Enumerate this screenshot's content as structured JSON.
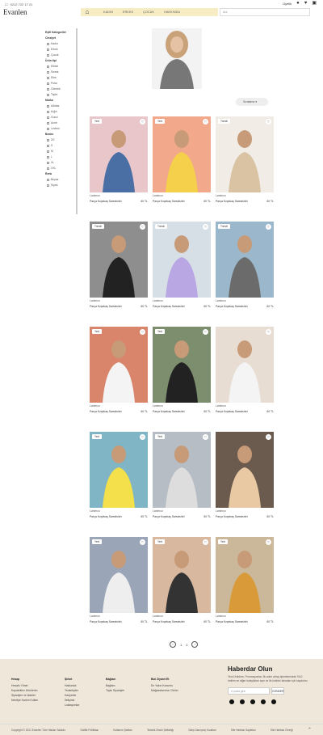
{
  "topbar": {
    "phone": "0212 722 17 21"
  },
  "header": {
    "logo": "Evanlen",
    "nav": [
      {
        "label": "KADIN"
      },
      {
        "label": "ERKEK"
      },
      {
        "label": "ÇOCUK"
      },
      {
        "label": "HAKKINDA"
      }
    ],
    "search_placeholder": "Ara",
    "user_label": "Üyelik"
  },
  "filters": {
    "groups": [
      {
        "title": "Eşfil Kategoriler",
        "items": []
      },
      {
        "title": "Cinsiyet",
        "items": [
          "Kadın",
          "Erkek",
          "Çocuk"
        ]
      },
      {
        "title": "Ürün tipi",
        "items": [
          "Elbise",
          "Sweat",
          "Etek",
          "Polar",
          "Gömlek",
          "Tişört"
        ]
      },
      {
        "title": "Marka",
        "items": [
          "Adidas",
          "Kığılı",
          "Gucci",
          "Acne",
          "Levimo"
        ]
      },
      {
        "title": "Beden",
        "items": [
          "XS",
          "S",
          "M",
          "L",
          "XL",
          "XXL"
        ]
      },
      {
        "title": "Renk",
        "items": [
          "Beyaz",
          "Siyah"
        ]
      }
    ]
  },
  "sort_label": "Sıralama",
  "products": [
    {
      "badge": "Yeni",
      "brand": "Lanimco",
      "name": "Parça Koşekaş Sweatshirt",
      "price": "60 TL"
    },
    {
      "badge": "Yeni",
      "brand": "Lanimco",
      "name": "Parça Koşekaş Sweatshirt",
      "price": "60 TL"
    },
    {
      "badge": "Trendl",
      "brand": "Lanimco",
      "name": "Parça Koşekaş Sweatshirt",
      "price": "60 TL"
    },
    {
      "badge": "Trendl",
      "brand": "Lanimco",
      "name": "Parça Koşekaş Sweatshirt",
      "price": "60 TL"
    },
    {
      "badge": "Trendl",
      "brand": "Lanimco",
      "name": "Parça Koşekaş Sweatshirt",
      "price": "60 TL"
    },
    {
      "badge": "Trendl",
      "brand": "Lanimco",
      "name": "Parça Koşekaş Sweatshirt",
      "price": "60 TL"
    },
    {
      "badge": "Yeni",
      "brand": "Lanimco",
      "name": "Parça Koşekaş Sweatshirt",
      "price": "60 TL"
    },
    {
      "badge": "Yeni",
      "brand": "Lanimco",
      "name": "Parça Koşekaş Sweatshirt",
      "price": "60 TL"
    },
    {
      "badge": "",
      "brand": "Lanimco",
      "name": "Parça Koşekaş Sweatshirt",
      "price": "60 TL"
    },
    {
      "badge": "Yeni",
      "brand": "Lanimco",
      "name": "Parça Koşekaş Sweatshirt",
      "price": "60 TL"
    },
    {
      "badge": "Yeni",
      "brand": "Lanimco",
      "name": "Parça Koşekaş Sweatshirt",
      "price": "60 TL"
    },
    {
      "badge": "",
      "brand": "Lanimco",
      "name": "Parça Koşekaş Sweatshirt",
      "price": "60 TL"
    },
    {
      "badge": "Yeni",
      "brand": "Lanimco",
      "name": "Parça Koşekaş Sweatshirt",
      "price": "60 TL"
    },
    {
      "badge": "Yeni",
      "brand": "Lanimco",
      "name": "Parça Koşekaş Sweatshirt",
      "price": "60 TL"
    },
    {
      "badge": "Yeni",
      "brand": "Lanimco",
      "name": "Parça Koşekaş Sweatshirt",
      "price": "60 TL"
    }
  ],
  "pager": {
    "pages": [
      "1",
      "2"
    ]
  },
  "footer": {
    "cols": [
      {
        "title": "Hesap",
        "links": [
          "Hesabı Yönet",
          "Kaydedilen Ürünlerim",
          "Siparişler ve İadeler",
          "Nerdiye Kartım Kullan"
        ]
      },
      {
        "title": "Şirket",
        "links": [
          "Hakkında",
          "Tedarikçiler",
          "Kariyerler",
          "İletişime",
          "Lokasyonlar"
        ]
      },
      {
        "title": "Bağlam",
        "links": [
          "Bağlam",
          "Toplu Siparişler"
        ]
      },
      {
        "title": "Bizi Ziyaret Et",
        "links": [
          "En Yakın Konumu",
          "Mağazalarımızı Görün"
        ]
      }
    ],
    "news_title": "Haberdar Olun",
    "news_text": "Yeni Ürünlere, Promosyonlar, İlk adım almış işlemlerinizde %10 indirim ve diğer kolaylıkları açın ve ilk indirimi alınaları için kaydolun.",
    "email_placeholder": "e-posta girin",
    "send_label": "GÖNDER",
    "bottom": [
      "Copyright © 2021 Evanlen Tüm Hakları Saklıdır",
      "Gizlilik Politikası",
      "Kullanım Şartları",
      "Tedarik Zinciri Şeffaflığı",
      "Satış Danışmış Kuralları",
      "Site Haritası Sayfaları",
      "Site Haritası Örneği"
    ]
  },
  "colors": {
    "nav_bg": "#f7edc5",
    "footer_bg": "#efe7d9"
  }
}
